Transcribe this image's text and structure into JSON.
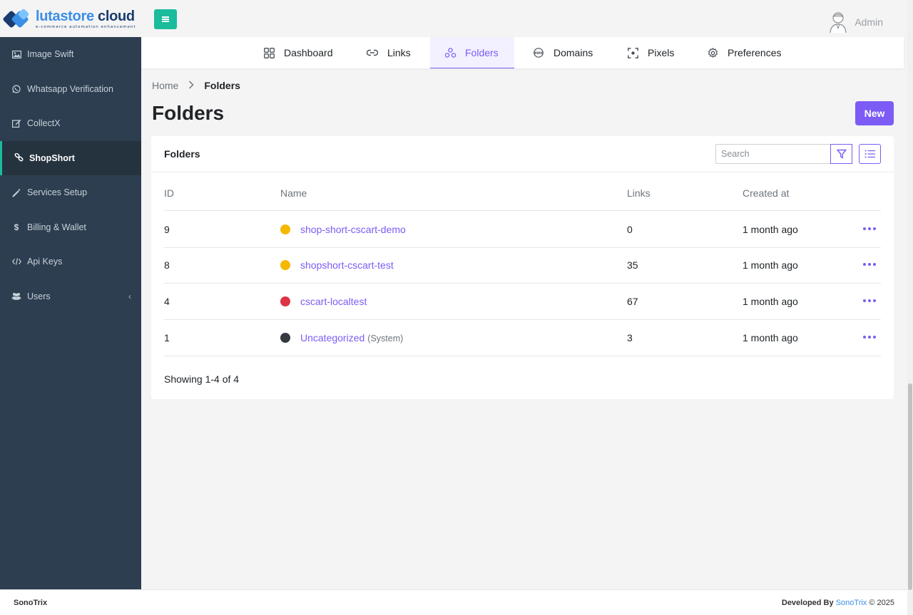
{
  "brand": {
    "title_part1": "lutastore",
    "title_part2": " cloud",
    "tagline": "e-commerce automation enhancement"
  },
  "header": {
    "user_name": "Admin"
  },
  "sidebar": {
    "items": [
      {
        "label": "Image Swift",
        "icon": "image-icon"
      },
      {
        "label": "Whatsapp Verification",
        "icon": "whatsapp-icon"
      },
      {
        "label": "CollectX",
        "icon": "edit-icon"
      },
      {
        "label": "ShopShort",
        "icon": "link-icon",
        "active": true
      },
      {
        "label": "Services Setup",
        "icon": "magic-wand-icon"
      },
      {
        "label": "Billing & Wallet",
        "icon": "dollar-icon"
      },
      {
        "label": "Api Keys",
        "icon": "code-icon"
      },
      {
        "label": "Users",
        "icon": "users-icon",
        "has_submenu": true
      }
    ]
  },
  "tabs": [
    {
      "label": "Dashboard",
      "icon": "grid-icon"
    },
    {
      "label": "Links",
      "icon": "link-icon"
    },
    {
      "label": "Folders",
      "icon": "folders-icon",
      "active": true
    },
    {
      "label": "Domains",
      "icon": "www-icon"
    },
    {
      "label": "Pixels",
      "icon": "focus-icon"
    },
    {
      "label": "Preferences",
      "icon": "gear-icon"
    }
  ],
  "breadcrumb": {
    "home": "Home",
    "current": "Folders"
  },
  "page": {
    "title": "Folders",
    "new_button": "New"
  },
  "card": {
    "title": "Folders",
    "search_placeholder": "Search"
  },
  "table": {
    "columns": [
      "ID",
      "Name",
      "Links",
      "Created at"
    ],
    "rows": [
      {
        "id": "9",
        "name": "shop-short-cscart-demo",
        "suffix": "",
        "links": "0",
        "created": "1 month ago",
        "color": "#f5b800"
      },
      {
        "id": "8",
        "name": "shopshort-cscart-test",
        "suffix": "",
        "links": "35",
        "created": "1 month ago",
        "color": "#f5b800"
      },
      {
        "id": "4",
        "name": "cscart-localtest",
        "suffix": "",
        "links": "67",
        "created": "1 month ago",
        "color": "#dc3545"
      },
      {
        "id": "1",
        "name": "Uncategorized",
        "suffix": "(System)",
        "links": "3",
        "created": "1 month ago",
        "color": "#343a40"
      }
    ],
    "showing": "Showing 1-4 of 4"
  },
  "footer": {
    "left": "SonoTrix",
    "right_prefix": "Developed By",
    "right_link": "SonoTrix",
    "right_suffix": "© 2025"
  },
  "colors": {
    "accent": "#7c5cf5",
    "sidebar_bg": "#2c3e50",
    "toggle": "#1abc9c"
  }
}
